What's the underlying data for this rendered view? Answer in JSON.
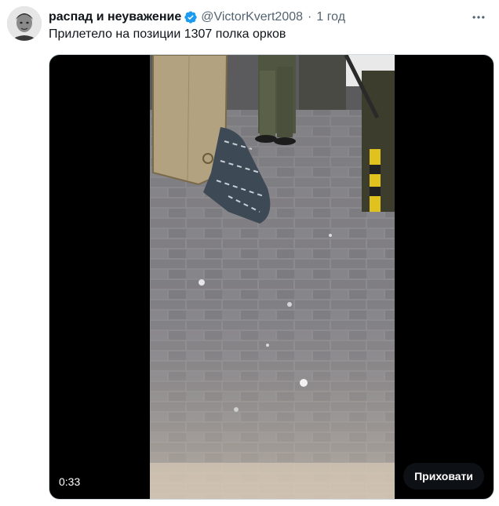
{
  "tweet": {
    "display_name": "распад и неуважение",
    "handle": "@VictorKvert2008",
    "separator": "·",
    "time": "1 год",
    "text": "Прилетело на позиции 1307 полка орков",
    "verified_icon": "verified-badge-icon",
    "more_icon": "more-options-icon"
  },
  "video": {
    "duration": "0:33",
    "hide_label": "Приховати"
  },
  "colors": {
    "verified": "#1d9bf0",
    "secondary_text": "#536471",
    "primary_text": "#0f1419"
  }
}
